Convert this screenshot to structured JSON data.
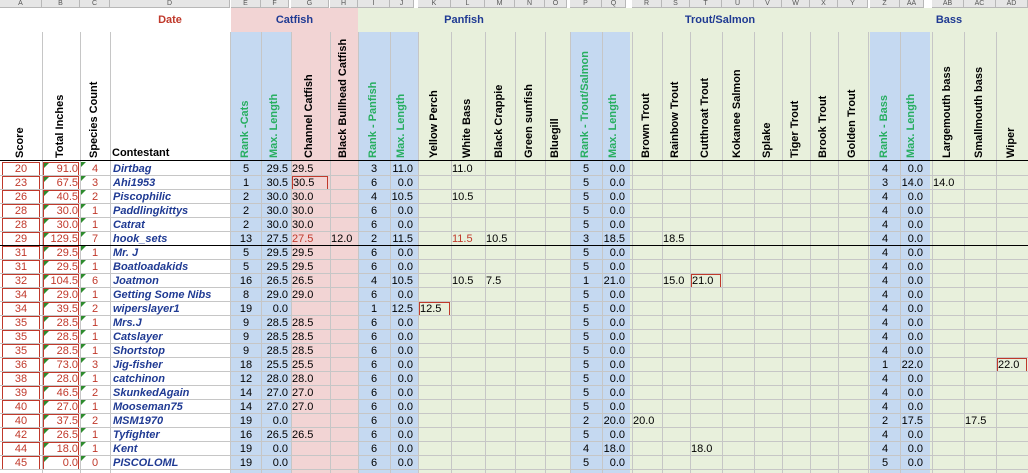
{
  "column_letters": [
    "A",
    "B",
    "C",
    "D",
    "E",
    "F",
    "G",
    "H",
    "I",
    "J",
    "K",
    "L",
    "M",
    "N",
    "O",
    "P",
    "Q",
    "R",
    "S",
    "T",
    "U",
    "V",
    "W",
    "X",
    "Y",
    "Z",
    "AA",
    "AB",
    "AC",
    "AD"
  ],
  "group_headers": {
    "date": "Date",
    "catfish": "Catfish",
    "panfish": "Panfish",
    "trout": "Trout/Salmon",
    "bass": "Bass"
  },
  "column_headers": {
    "score": "Score",
    "total_inches": "Total Inches",
    "species_count": "Species Count",
    "contestant": "Contestant",
    "rank_cats": "Rank -Cats",
    "cat_max": "Max. Length",
    "channel_catfish": "Channel Catfish",
    "black_bullhead": "Black Bullhead Catfish",
    "rank_panfish": "Rank - Panfish",
    "pan_max": "Max. Length",
    "yellow_perch": "Yellow Perch",
    "white_bass": "White Bass",
    "black_crappie": "Black Crappie",
    "green_sunfish": "Green sunfish",
    "bluegill": "Bluegill",
    "rank_trout": "Rank - Trout/Salmon",
    "trout_max": "Max. Length",
    "brown_trout": "Brown Trout",
    "rainbow_trout": "Rainbow Trout",
    "cutthroat_trout": "Cutthroat Trout",
    "kokanee_salmon": "Kokanee Salmon",
    "splake": "Splake",
    "tiger_trout": "Tiger Trout",
    "brook_trout": "Brook Trout",
    "golden_trout": "Golden Trout",
    "rank_bass": "Rank - Bass",
    "bass_max": "Max. Length",
    "largemouth_bass": "Largemouth bass",
    "smallmouth_bass": "Smallmouth bass",
    "wiper": "Wiper"
  },
  "colors": {
    "header_red": "#c0392b",
    "header_blue": "#1f3a93",
    "header_green": "#27ae60",
    "catfish_band": "#f2d4d4",
    "panfish_band": "#e8f0dc",
    "trout_band": "#e8f0dc",
    "rank_band": "#c5d9f1",
    "bass_band": "#e8f0dc",
    "contestant_blue": "#1f3a93",
    "flag_green": "#2e8b2e"
  },
  "rows": [
    {
      "score": "20",
      "total": "91.0",
      "species": "4",
      "contestant": "Dirtbag",
      "rank_cats": "5",
      "cat_max": "29.5",
      "channel": "29.5",
      "bullhead": "",
      "rank_pan": "3",
      "pan_max": "11.0",
      "yellow_perch": "",
      "white_bass": "11.0",
      "black_crappie": "",
      "green_sunfish": "",
      "bluegill": "",
      "rank_trout": "5",
      "trout_max": "0.0",
      "brown": "",
      "rainbow": "",
      "cutthroat": "",
      "kokanee": "",
      "splake": "",
      "tiger": "",
      "brook": "",
      "golden": "",
      "rank_bass": "4",
      "bass_max": "0.0",
      "largemouth": "",
      "smallmouth": "",
      "wiper": ""
    },
    {
      "score": "23",
      "total": "67.5",
      "species": "3",
      "contestant": "Ahi1953",
      "rank_cats": "1",
      "cat_max": "30.5",
      "channel": "30.5",
      "bullhead": "",
      "rank_pan": "6",
      "pan_max": "0.0",
      "yellow_perch": "",
      "white_bass": "",
      "black_crappie": "",
      "green_sunfish": "",
      "bluegill": "",
      "rank_trout": "5",
      "trout_max": "0.0",
      "brown": "",
      "rainbow": "",
      "cutthroat": "",
      "kokanee": "",
      "splake": "",
      "tiger": "",
      "brook": "",
      "golden": "",
      "rank_bass": "3",
      "bass_max": "14.0",
      "largemouth": "14.0",
      "smallmouth": "",
      "wiper": ""
    },
    {
      "score": "26",
      "total": "40.5",
      "species": "2",
      "contestant": "Piscophilic",
      "rank_cats": "2",
      "cat_max": "30.0",
      "channel": "30.0",
      "bullhead": "",
      "rank_pan": "4",
      "pan_max": "10.5",
      "yellow_perch": "",
      "white_bass": "10.5",
      "black_crappie": "",
      "green_sunfish": "",
      "bluegill": "",
      "rank_trout": "5",
      "trout_max": "0.0",
      "brown": "",
      "rainbow": "",
      "cutthroat": "",
      "kokanee": "",
      "splake": "",
      "tiger": "",
      "brook": "",
      "golden": "",
      "rank_bass": "4",
      "bass_max": "0.0",
      "largemouth": "",
      "smallmouth": "",
      "wiper": ""
    },
    {
      "score": "28",
      "total": "30.0",
      "species": "1",
      "contestant": "Paddlingkittys",
      "rank_cats": "2",
      "cat_max": "30.0",
      "channel": "30.0",
      "bullhead": "",
      "rank_pan": "6",
      "pan_max": "0.0",
      "yellow_perch": "",
      "white_bass": "",
      "black_crappie": "",
      "green_sunfish": "",
      "bluegill": "",
      "rank_trout": "5",
      "trout_max": "0.0",
      "brown": "",
      "rainbow": "",
      "cutthroat": "",
      "kokanee": "",
      "splake": "",
      "tiger": "",
      "brook": "",
      "golden": "",
      "rank_bass": "4",
      "bass_max": "0.0",
      "largemouth": "",
      "smallmouth": "",
      "wiper": ""
    },
    {
      "score": "28",
      "total": "30.0",
      "species": "1",
      "contestant": "Catrat",
      "rank_cats": "2",
      "cat_max": "30.0",
      "channel": "30.0",
      "bullhead": "",
      "rank_pan": "6",
      "pan_max": "0.0",
      "yellow_perch": "",
      "white_bass": "",
      "black_crappie": "",
      "green_sunfish": "",
      "bluegill": "",
      "rank_trout": "5",
      "trout_max": "0.0",
      "brown": "",
      "rainbow": "",
      "cutthroat": "",
      "kokanee": "",
      "splake": "",
      "tiger": "",
      "brook": "",
      "golden": "",
      "rank_bass": "4",
      "bass_max": "0.0",
      "largemouth": "",
      "smallmouth": "",
      "wiper": ""
    },
    {
      "score": "29",
      "total": "129.5",
      "species": "7",
      "contestant": "hook_sets",
      "rank_cats": "13",
      "cat_max": "27.5",
      "channel": "27.5",
      "bullhead": "12.0",
      "rank_pan": "2",
      "pan_max": "11.5",
      "yellow_perch": "",
      "white_bass": "11.5",
      "black_crappie": "10.5",
      "green_sunfish": "",
      "bluegill": "",
      "rank_trout": "3",
      "trout_max": "18.5",
      "brown": "",
      "rainbow": "18.5",
      "cutthroat": "",
      "kokanee": "",
      "splake": "",
      "tiger": "",
      "brook": "",
      "golden": "",
      "rank_bass": "4",
      "bass_max": "0.0",
      "largemouth": "",
      "smallmouth": "",
      "wiper": ""
    },
    {
      "score": "31",
      "total": "29.5",
      "species": "1",
      "contestant": "Mr. J",
      "rank_cats": "5",
      "cat_max": "29.5",
      "channel": "29.5",
      "bullhead": "",
      "rank_pan": "6",
      "pan_max": "0.0",
      "yellow_perch": "",
      "white_bass": "",
      "black_crappie": "",
      "green_sunfish": "",
      "bluegill": "",
      "rank_trout": "5",
      "trout_max": "0.0",
      "brown": "",
      "rainbow": "",
      "cutthroat": "",
      "kokanee": "",
      "splake": "",
      "tiger": "",
      "brook": "",
      "golden": "",
      "rank_bass": "4",
      "bass_max": "0.0",
      "largemouth": "",
      "smallmouth": "",
      "wiper": ""
    },
    {
      "score": "31",
      "total": "29.5",
      "species": "1",
      "contestant": "Boatloadakids",
      "rank_cats": "5",
      "cat_max": "29.5",
      "channel": "29.5",
      "bullhead": "",
      "rank_pan": "6",
      "pan_max": "0.0",
      "yellow_perch": "",
      "white_bass": "",
      "black_crappie": "",
      "green_sunfish": "",
      "bluegill": "",
      "rank_trout": "5",
      "trout_max": "0.0",
      "brown": "",
      "rainbow": "",
      "cutthroat": "",
      "kokanee": "",
      "splake": "",
      "tiger": "",
      "brook": "",
      "golden": "",
      "rank_bass": "4",
      "bass_max": "0.0",
      "largemouth": "",
      "smallmouth": "",
      "wiper": ""
    },
    {
      "score": "32",
      "total": "104.5",
      "species": "6",
      "contestant": "Joatmon",
      "rank_cats": "16",
      "cat_max": "26.5",
      "channel": "26.5",
      "bullhead": "",
      "rank_pan": "4",
      "pan_max": "10.5",
      "yellow_perch": "",
      "white_bass": "10.5",
      "black_crappie": "7.5",
      "green_sunfish": "",
      "bluegill": "",
      "rank_trout": "1",
      "trout_max": "21.0",
      "brown": "",
      "rainbow": "15.0",
      "cutthroat": "21.0",
      "kokanee": "",
      "splake": "",
      "tiger": "",
      "brook": "",
      "golden": "",
      "rank_bass": "4",
      "bass_max": "0.0",
      "largemouth": "",
      "smallmouth": "",
      "wiper": ""
    },
    {
      "score": "34",
      "total": "29.0",
      "species": "1",
      "contestant": "Getting Some Nibs",
      "rank_cats": "8",
      "cat_max": "29.0",
      "channel": "29.0",
      "bullhead": "",
      "rank_pan": "6",
      "pan_max": "0.0",
      "yellow_perch": "",
      "white_bass": "",
      "black_crappie": "",
      "green_sunfish": "",
      "bluegill": "",
      "rank_trout": "5",
      "trout_max": "0.0",
      "brown": "",
      "rainbow": "",
      "cutthroat": "",
      "kokanee": "",
      "splake": "",
      "tiger": "",
      "brook": "",
      "golden": "",
      "rank_bass": "4",
      "bass_max": "0.0",
      "largemouth": "",
      "smallmouth": "",
      "wiper": ""
    },
    {
      "score": "34",
      "total": "39.5",
      "species": "2",
      "contestant": "wiperslayer1",
      "rank_cats": "19",
      "cat_max": "0.0",
      "channel": "",
      "bullhead": "",
      "rank_pan": "1",
      "pan_max": "12.5",
      "yellow_perch": "12.5",
      "white_bass": "",
      "black_crappie": "",
      "green_sunfish": "",
      "bluegill": "",
      "rank_trout": "5",
      "trout_max": "0.0",
      "brown": "",
      "rainbow": "",
      "cutthroat": "",
      "kokanee": "",
      "splake": "",
      "tiger": "",
      "brook": "",
      "golden": "",
      "rank_bass": "4",
      "bass_max": "0.0",
      "largemouth": "",
      "smallmouth": "",
      "wiper": ""
    },
    {
      "score": "35",
      "total": "28.5",
      "species": "1",
      "contestant": "Mrs.J",
      "rank_cats": "9",
      "cat_max": "28.5",
      "channel": "28.5",
      "bullhead": "",
      "rank_pan": "6",
      "pan_max": "0.0",
      "yellow_perch": "",
      "white_bass": "",
      "black_crappie": "",
      "green_sunfish": "",
      "bluegill": "",
      "rank_trout": "5",
      "trout_max": "0.0",
      "brown": "",
      "rainbow": "",
      "cutthroat": "",
      "kokanee": "",
      "splake": "",
      "tiger": "",
      "brook": "",
      "golden": "",
      "rank_bass": "4",
      "bass_max": "0.0",
      "largemouth": "",
      "smallmouth": "",
      "wiper": ""
    },
    {
      "score": "35",
      "total": "28.5",
      "species": "1",
      "contestant": "Catslayer",
      "rank_cats": "9",
      "cat_max": "28.5",
      "channel": "28.5",
      "bullhead": "",
      "rank_pan": "6",
      "pan_max": "0.0",
      "yellow_perch": "",
      "white_bass": "",
      "black_crappie": "",
      "green_sunfish": "",
      "bluegill": "",
      "rank_trout": "5",
      "trout_max": "0.0",
      "brown": "",
      "rainbow": "",
      "cutthroat": "",
      "kokanee": "",
      "splake": "",
      "tiger": "",
      "brook": "",
      "golden": "",
      "rank_bass": "4",
      "bass_max": "0.0",
      "largemouth": "",
      "smallmouth": "",
      "wiper": ""
    },
    {
      "score": "35",
      "total": "28.5",
      "species": "1",
      "contestant": "Shortstop",
      "rank_cats": "9",
      "cat_max": "28.5",
      "channel": "28.5",
      "bullhead": "",
      "rank_pan": "6",
      "pan_max": "0.0",
      "yellow_perch": "",
      "white_bass": "",
      "black_crappie": "",
      "green_sunfish": "",
      "bluegill": "",
      "rank_trout": "5",
      "trout_max": "0.0",
      "brown": "",
      "rainbow": "",
      "cutthroat": "",
      "kokanee": "",
      "splake": "",
      "tiger": "",
      "brook": "",
      "golden": "",
      "rank_bass": "4",
      "bass_max": "0.0",
      "largemouth": "",
      "smallmouth": "",
      "wiper": ""
    },
    {
      "score": "36",
      "total": "73.0",
      "species": "3",
      "contestant": "Jig-fisher",
      "rank_cats": "18",
      "cat_max": "25.5",
      "channel": "25.5",
      "bullhead": "",
      "rank_pan": "6",
      "pan_max": "0.0",
      "yellow_perch": "",
      "white_bass": "",
      "black_crappie": "",
      "green_sunfish": "",
      "bluegill": "",
      "rank_trout": "5",
      "trout_max": "0.0",
      "brown": "",
      "rainbow": "",
      "cutthroat": "",
      "kokanee": "",
      "splake": "",
      "tiger": "",
      "brook": "",
      "golden": "",
      "rank_bass": "1",
      "bass_max": "22.0",
      "largemouth": "",
      "smallmouth": "",
      "wiper": "22.0"
    },
    {
      "score": "38",
      "total": "28.0",
      "species": "1",
      "contestant": "catchinon",
      "rank_cats": "12",
      "cat_max": "28.0",
      "channel": "28.0",
      "bullhead": "",
      "rank_pan": "6",
      "pan_max": "0.0",
      "yellow_perch": "",
      "white_bass": "",
      "black_crappie": "",
      "green_sunfish": "",
      "bluegill": "",
      "rank_trout": "5",
      "trout_max": "0.0",
      "brown": "",
      "rainbow": "",
      "cutthroat": "",
      "kokanee": "",
      "splake": "",
      "tiger": "",
      "brook": "",
      "golden": "",
      "rank_bass": "4",
      "bass_max": "0.0",
      "largemouth": "",
      "smallmouth": "",
      "wiper": ""
    },
    {
      "score": "39",
      "total": "46.5",
      "species": "2",
      "contestant": "SkunkedAgain",
      "rank_cats": "14",
      "cat_max": "27.0",
      "channel": "27.0",
      "bullhead": "",
      "rank_pan": "6",
      "pan_max": "0.0",
      "yellow_perch": "",
      "white_bass": "",
      "black_crappie": "",
      "green_sunfish": "",
      "bluegill": "",
      "rank_trout": "5",
      "trout_max": "0.0",
      "brown": "",
      "rainbow": "",
      "cutthroat": "",
      "kokanee": "",
      "splake": "",
      "tiger": "",
      "brook": "",
      "golden": "",
      "rank_bass": "4",
      "bass_max": "0.0",
      "largemouth": "",
      "smallmouth": "",
      "wiper": ""
    },
    {
      "score": "40",
      "total": "27.0",
      "species": "1",
      "contestant": "Mooseman75",
      "rank_cats": "14",
      "cat_max": "27.0",
      "channel": "27.0",
      "bullhead": "",
      "rank_pan": "6",
      "pan_max": "0.0",
      "yellow_perch": "",
      "white_bass": "",
      "black_crappie": "",
      "green_sunfish": "",
      "bluegill": "",
      "rank_trout": "5",
      "trout_max": "0.0",
      "brown": "",
      "rainbow": "",
      "cutthroat": "",
      "kokanee": "",
      "splake": "",
      "tiger": "",
      "brook": "",
      "golden": "",
      "rank_bass": "4",
      "bass_max": "0.0",
      "largemouth": "",
      "smallmouth": "",
      "wiper": ""
    },
    {
      "score": "40",
      "total": "37.5",
      "species": "2",
      "contestant": "MSM1970",
      "rank_cats": "19",
      "cat_max": "0.0",
      "channel": "",
      "bullhead": "",
      "rank_pan": "6",
      "pan_max": "0.0",
      "yellow_perch": "",
      "white_bass": "",
      "black_crappie": "",
      "green_sunfish": "",
      "bluegill": "",
      "rank_trout": "2",
      "trout_max": "20.0",
      "brown": "20.0",
      "rainbow": "",
      "cutthroat": "",
      "kokanee": "",
      "splake": "",
      "tiger": "",
      "brook": "",
      "golden": "",
      "rank_bass": "2",
      "bass_max": "17.5",
      "largemouth": "",
      "smallmouth": "17.5",
      "wiper": ""
    },
    {
      "score": "42",
      "total": "26.5",
      "species": "1",
      "contestant": "Tyfighter",
      "rank_cats": "16",
      "cat_max": "26.5",
      "channel": "26.5",
      "bullhead": "",
      "rank_pan": "6",
      "pan_max": "0.0",
      "yellow_perch": "",
      "white_bass": "",
      "black_crappie": "",
      "green_sunfish": "",
      "bluegill": "",
      "rank_trout": "5",
      "trout_max": "0.0",
      "brown": "",
      "rainbow": "",
      "cutthroat": "",
      "kokanee": "",
      "splake": "",
      "tiger": "",
      "brook": "",
      "golden": "",
      "rank_bass": "4",
      "bass_max": "0.0",
      "largemouth": "",
      "smallmouth": "",
      "wiper": ""
    },
    {
      "score": "44",
      "total": "18.0",
      "species": "1",
      "contestant": "Kent",
      "rank_cats": "19",
      "cat_max": "0.0",
      "channel": "",
      "bullhead": "",
      "rank_pan": "6",
      "pan_max": "0.0",
      "yellow_perch": "",
      "white_bass": "",
      "black_crappie": "",
      "green_sunfish": "",
      "bluegill": "",
      "rank_trout": "4",
      "trout_max": "18.0",
      "brown": "",
      "rainbow": "",
      "cutthroat": "18.0",
      "kokanee": "",
      "splake": "",
      "tiger": "",
      "brook": "",
      "golden": "",
      "rank_bass": "4",
      "bass_max": "0.0",
      "largemouth": "",
      "smallmouth": "",
      "wiper": ""
    },
    {
      "score": "45",
      "total": "0.0",
      "species": "0",
      "contestant": "PISCOLOML",
      "rank_cats": "19",
      "cat_max": "0.0",
      "channel": "",
      "bullhead": "",
      "rank_pan": "6",
      "pan_max": "0.0",
      "yellow_perch": "",
      "white_bass": "",
      "black_crappie": "",
      "green_sunfish": "",
      "bluegill": "",
      "rank_trout": "5",
      "trout_max": "0.0",
      "brown": "",
      "rainbow": "",
      "cutthroat": "",
      "kokanee": "",
      "splake": "",
      "tiger": "",
      "brook": "",
      "golden": "",
      "rank_bass": "5",
      "bass_max": "0.0",
      "largemouth": "",
      "smallmouth": "",
      "wiper": ""
    }
  ]
}
